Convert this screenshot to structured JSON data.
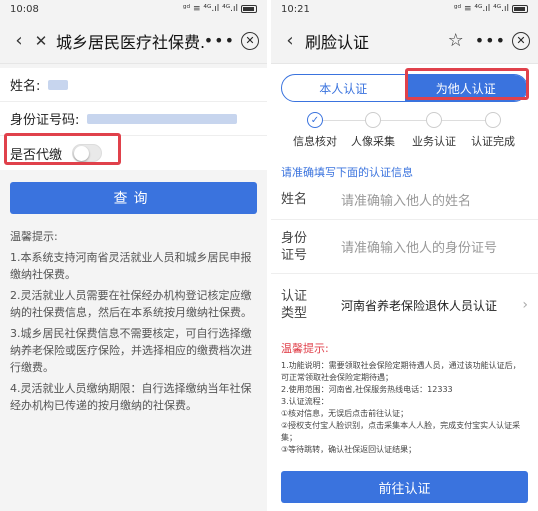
{
  "left": {
    "status": {
      "time": "10:08",
      "icons": "ᵍᵈ ≡ ⁴ᴳ.ıl ⁴ᴳ.ıl"
    },
    "nav": {
      "back": "‹",
      "close": "✕",
      "title": "城乡居民医疗社保费...",
      "more": "•••",
      "circle": "⊗"
    },
    "form": {
      "name_label": "姓名:",
      "id_label": "身份证号码:",
      "proxy_label": "是否代缴",
      "proxy_on": false
    },
    "query_label": "查询",
    "tips": {
      "title": "温馨提示:",
      "items": [
        "1.本系统支持河南省灵活就业人员和城乡居民申报缴纳社保费。",
        "2.灵活就业人员需要在社保经办机构登记核定应缴纳的社保费信息，然后在本系统按月缴纳社保费。",
        "3.城乡居民社保费信息不需要核定，可自行选择缴纳养老保险或医疗保险，并选择相应的缴费档次进行缴费。",
        "4.灵活就业人员缴纳期限：自行选择缴纳当年社保经办机构已传递的按月缴纳的社保费。"
      ]
    }
  },
  "right": {
    "status": {
      "time": "10:21",
      "icons": "ᵍᵈ ≡ ⁴ᴳ.ıl ⁴ᴳ.ıl"
    },
    "nav": {
      "back": "‹",
      "title": "刷脸认证",
      "star": "☆",
      "more": "•••",
      "circle": "⊗"
    },
    "tabs": {
      "self": "本人认证",
      "other": "为他人认证"
    },
    "steps": [
      "信息核对",
      "人像采集",
      "业务认证",
      "认证完成"
    ],
    "section_title": "请准确填写下面的认证信息",
    "fields": {
      "name_label": "姓名",
      "name_placeholder": "请准确输入他人的姓名",
      "id_label": "身份证号",
      "id_placeholder": "请准确输入他人的身份证号",
      "type_label": "认证类型",
      "type_value": "河南省养老保险退休人员认证"
    },
    "tips_title": "温馨提示:",
    "tips": [
      "1.功能说明：需要领取社会保险定期待遇人员，通过该功能认证后，可正常领取社会保险定期待遇；",
      "2.使用范围：河南省,社保服务热线电话：12333",
      "3.认证流程：",
      "①核对信息，无误后点击前往认证；",
      "②授权支付宝人脸识别，点击采集本人人脸，完成支付宝实人认证采集；",
      "③等待跳转，确认社保返回认证结果；"
    ],
    "go_label": "前往认证"
  },
  "colors": {
    "accent": "#3a73de",
    "highlight": "#e0414b"
  }
}
